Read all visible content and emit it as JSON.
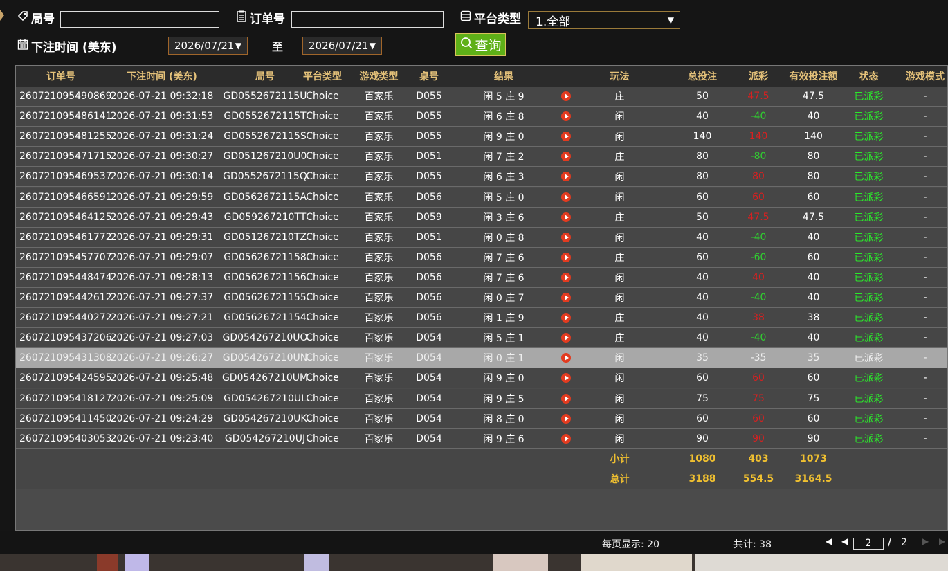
{
  "filters": {
    "round_label": "局号",
    "round_value": "",
    "order_label": "订单号",
    "order_value": "",
    "platform_label": "平台类型",
    "platform_value": "1.全部",
    "time_label": "下注时间 (美东)",
    "date_from": "2026/07/21",
    "to_label": "至",
    "date_to": "2026/07/21",
    "query_label": "查询"
  },
  "table": {
    "headers": [
      "订单号",
      "下注时间 (美东)",
      "局号",
      "平台类型",
      "游戏类型",
      "桌号",
      "结果",
      "",
      "玩法",
      "总投注",
      "派彩",
      "有效投注额",
      "状态",
      "游戏模式"
    ],
    "rows": [
      {
        "order": "260721095490869",
        "time": "2026-07-21 09:32:18",
        "round": "GD0552672115U",
        "platform": "Choice",
        "game": "百家乐",
        "table": "D055",
        "result": "闲 5 庄 9",
        "play": "庄",
        "bet": "50",
        "payout": "47.5",
        "payout_color": "red",
        "valid": "47.5",
        "status": "已派彩",
        "mode": "-"
      },
      {
        "order": "260721095486141",
        "time": "2026-07-21 09:31:53",
        "round": "GD0552672115T",
        "platform": "Choice",
        "game": "百家乐",
        "table": "D055",
        "result": "闲 6 庄 8",
        "play": "闲",
        "bet": "40",
        "payout": "-40",
        "payout_color": "green",
        "valid": "40",
        "status": "已派彩",
        "mode": "-"
      },
      {
        "order": "260721095481255",
        "time": "2026-07-21 09:31:24",
        "round": "GD0552672115S",
        "platform": "Choice",
        "game": "百家乐",
        "table": "D055",
        "result": "闲 9 庄 0",
        "play": "闲",
        "bet": "140",
        "payout": "140",
        "payout_color": "red",
        "valid": "140",
        "status": "已派彩",
        "mode": "-"
      },
      {
        "order": "260721095471715",
        "time": "2026-07-21 09:30:27",
        "round": "GD051267210U0",
        "platform": "Choice",
        "game": "百家乐",
        "table": "D051",
        "result": "闲 7 庄 2",
        "play": "庄",
        "bet": "80",
        "payout": "-80",
        "payout_color": "green",
        "valid": "80",
        "status": "已派彩",
        "mode": "-"
      },
      {
        "order": "260721095469537",
        "time": "2026-07-21 09:30:14",
        "round": "GD0552672115Q",
        "platform": "Choice",
        "game": "百家乐",
        "table": "D055",
        "result": "闲 6 庄 3",
        "play": "闲",
        "bet": "80",
        "payout": "80",
        "payout_color": "red",
        "valid": "80",
        "status": "已派彩",
        "mode": "-"
      },
      {
        "order": "260721095466591",
        "time": "2026-07-21 09:29:59",
        "round": "GD0562672115A",
        "platform": "Choice",
        "game": "百家乐",
        "table": "D056",
        "result": "闲 5 庄 0",
        "play": "闲",
        "bet": "60",
        "payout": "60",
        "payout_color": "red",
        "valid": "60",
        "status": "已派彩",
        "mode": "-"
      },
      {
        "order": "260721095464125",
        "time": "2026-07-21 09:29:43",
        "round": "GD059267210TT",
        "platform": "Choice",
        "game": "百家乐",
        "table": "D059",
        "result": "闲 3 庄 6",
        "play": "庄",
        "bet": "50",
        "payout": "47.5",
        "payout_color": "red",
        "valid": "47.5",
        "status": "已派彩",
        "mode": "-"
      },
      {
        "order": "260721095461772",
        "time": "2026-07-21 09:29:31",
        "round": "GD051267210TZ",
        "platform": "Choice",
        "game": "百家乐",
        "table": "D051",
        "result": "闲 0 庄 8",
        "play": "闲",
        "bet": "40",
        "payout": "-40",
        "payout_color": "green",
        "valid": "40",
        "status": "已派彩",
        "mode": "-"
      },
      {
        "order": "260721095457707",
        "time": "2026-07-21 09:29:07",
        "round": "GD05626721158",
        "platform": "Choice",
        "game": "百家乐",
        "table": "D056",
        "result": "闲 7 庄 6",
        "play": "庄",
        "bet": "60",
        "payout": "-60",
        "payout_color": "green",
        "valid": "60",
        "status": "已派彩",
        "mode": "-"
      },
      {
        "order": "260721095448474",
        "time": "2026-07-21 09:28:13",
        "round": "GD05626721156",
        "platform": "Choice",
        "game": "百家乐",
        "table": "D056",
        "result": "闲 7 庄 6",
        "play": "闲",
        "bet": "40",
        "payout": "40",
        "payout_color": "red",
        "valid": "40",
        "status": "已派彩",
        "mode": "-"
      },
      {
        "order": "260721095442612",
        "time": "2026-07-21 09:27:37",
        "round": "GD05626721155",
        "platform": "Choice",
        "game": "百家乐",
        "table": "D056",
        "result": "闲 0 庄 7",
        "play": "闲",
        "bet": "40",
        "payout": "-40",
        "payout_color": "green",
        "valid": "40",
        "status": "已派彩",
        "mode": "-"
      },
      {
        "order": "260721095440272",
        "time": "2026-07-21 09:27:21",
        "round": "GD05626721154",
        "platform": "Choice",
        "game": "百家乐",
        "table": "D056",
        "result": "闲 1 庄 9",
        "play": "庄",
        "bet": "40",
        "payout": "38",
        "payout_color": "red",
        "valid": "38",
        "status": "已派彩",
        "mode": "-"
      },
      {
        "order": "260721095437206",
        "time": "2026-07-21 09:27:03",
        "round": "GD054267210UO",
        "platform": "Choice",
        "game": "百家乐",
        "table": "D054",
        "result": "闲 5 庄 1",
        "play": "庄",
        "bet": "40",
        "payout": "-40",
        "payout_color": "green",
        "valid": "40",
        "status": "已派彩",
        "mode": "-"
      },
      {
        "order": "260721095431308",
        "time": "2026-07-21 09:26:27",
        "round": "GD054267210UN",
        "platform": "Choice",
        "game": "百家乐",
        "table": "D054",
        "result": "闲 0 庄 1",
        "play": "闲",
        "bet": "35",
        "payout": "-35",
        "payout_color": "green",
        "valid": "35",
        "status": "已派彩",
        "mode": "-"
      },
      {
        "order": "260721095424595",
        "time": "2026-07-21 09:25:48",
        "round": "GD054267210UM",
        "platform": "Choice",
        "game": "百家乐",
        "table": "D054",
        "result": "闲 9 庄 0",
        "play": "闲",
        "bet": "60",
        "payout": "60",
        "payout_color": "red",
        "valid": "60",
        "status": "已派彩",
        "mode": "-"
      },
      {
        "order": "260721095418127",
        "time": "2026-07-21 09:25:09",
        "round": "GD054267210UL",
        "platform": "Choice",
        "game": "百家乐",
        "table": "D054",
        "result": "闲 9 庄 5",
        "play": "闲",
        "bet": "75",
        "payout": "75",
        "payout_color": "red",
        "valid": "75",
        "status": "已派彩",
        "mode": "-"
      },
      {
        "order": "260721095411450",
        "time": "2026-07-21 09:24:29",
        "round": "GD054267210UK",
        "platform": "Choice",
        "game": "百家乐",
        "table": "D054",
        "result": "闲 8 庄 0",
        "play": "闲",
        "bet": "60",
        "payout": "60",
        "payout_color": "red",
        "valid": "60",
        "status": "已派彩",
        "mode": "-"
      },
      {
        "order": "260721095403053",
        "time": "2026-07-21 09:23:40",
        "round": "GD054267210UJ",
        "platform": "Choice",
        "game": "百家乐",
        "table": "D054",
        "result": "闲 9 庄 6",
        "play": "闲",
        "bet": "90",
        "payout": "90",
        "payout_color": "red",
        "valid": "90",
        "status": "已派彩",
        "mode": "-"
      }
    ],
    "highlighted_row": 13,
    "subtotal": {
      "label": "小计",
      "bet": "1080",
      "payout": "403",
      "valid": "1073"
    },
    "total": {
      "label": "总计",
      "bet": "3188",
      "payout": "554.5",
      "valid": "3164.5"
    }
  },
  "footer": {
    "per_page": "每页显示: 20",
    "total_count": "共计: 38",
    "current_page": "2",
    "separator": "/",
    "total_pages": "2"
  },
  "colors": {
    "header_text": "#e5c27a",
    "payout_red": "#d92020",
    "payout_green": "#30d030",
    "status_green": "#2be82b",
    "sum_text": "#f0c030",
    "query_button": "#5eb018"
  }
}
